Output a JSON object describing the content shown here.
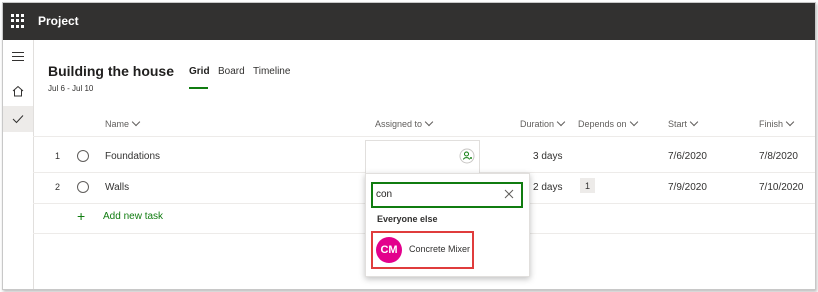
{
  "app": {
    "title": "Project"
  },
  "plan": {
    "title": "Building the house",
    "dates": "Jul 6 - Jul 10"
  },
  "tabs": [
    {
      "label": "Grid",
      "active": true
    },
    {
      "label": "Board",
      "active": false
    },
    {
      "label": "Timeline",
      "active": false
    }
  ],
  "columns": {
    "name": "Name",
    "assigned": "Assigned to",
    "duration": "Duration",
    "depends": "Depends on",
    "start": "Start",
    "finish": "Finish"
  },
  "rows": [
    {
      "num": "1",
      "name": "Foundations",
      "duration": "3 days",
      "depends": "",
      "start": "7/6/2020",
      "finish": "7/8/2020"
    },
    {
      "num": "2",
      "name": "Walls",
      "duration": "2 days",
      "depends": "1",
      "start": "7/9/2020",
      "finish": "7/10/2020"
    }
  ],
  "add_task": {
    "label": "Add new task"
  },
  "assign_popup": {
    "search_value": "con",
    "group_label": "Everyone else",
    "suggestion": {
      "initials": "CM",
      "name": "Concrete Mixer",
      "avatar_color": "#e3008c"
    }
  },
  "colors": {
    "accent": "#107c10",
    "topbar": "#323130",
    "highlight": "#e03c3c"
  },
  "icons": {
    "waffle": "app-launcher-icon",
    "menu": "hamburger-icon",
    "home": "home-icon",
    "check": "checkmark-icon",
    "assign": "person-add-icon",
    "clear": "close-icon",
    "add": "plus-icon"
  }
}
